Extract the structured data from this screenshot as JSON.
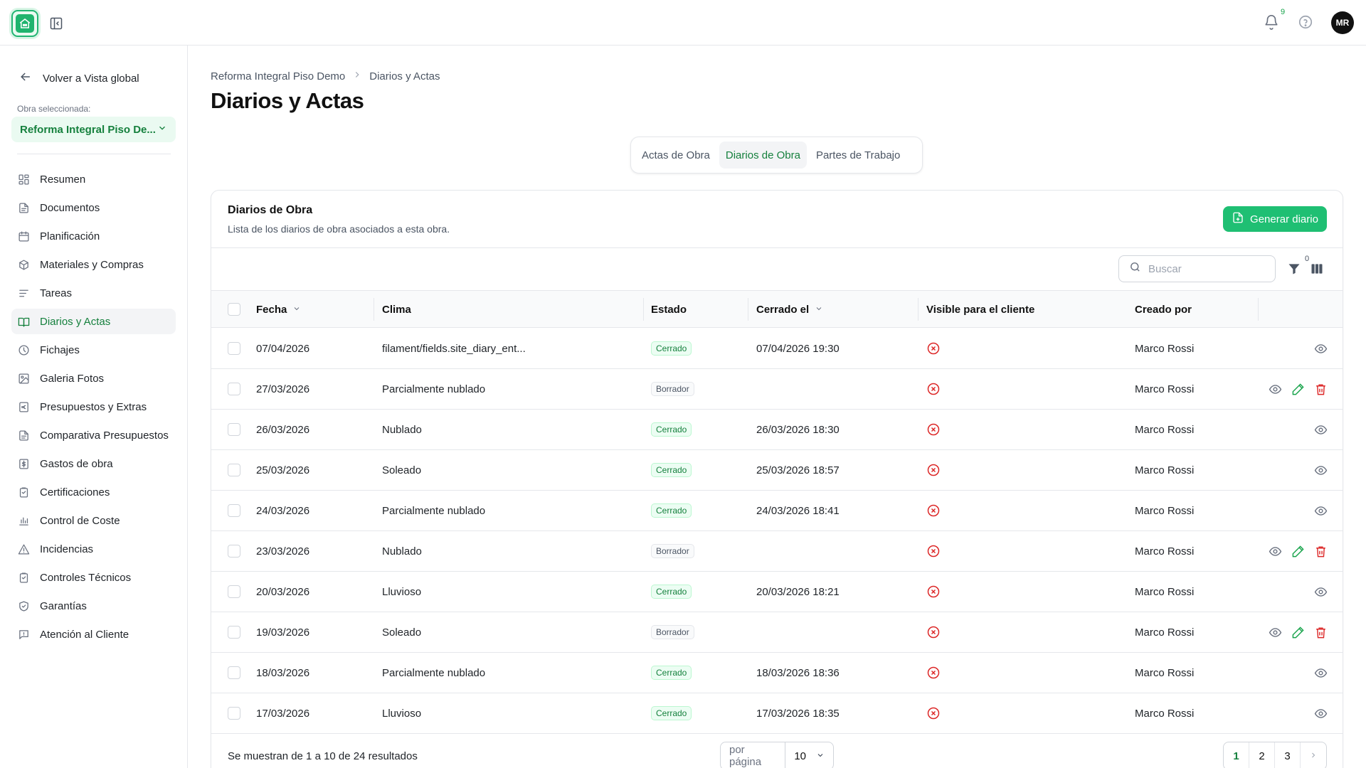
{
  "topbar": {
    "logo_icon": "house-icon",
    "collapse_icon": "sidebar-collapse-icon",
    "notifications_count": "9",
    "help_icon": "help-circle-icon",
    "avatar_initials": "MR",
    "accent_color": "#1fbf73"
  },
  "sidebar": {
    "back_label": "Volver a Vista global",
    "obra_label": "Obra seleccionada:",
    "obra_value": "Reforma Integral Piso De...",
    "items": [
      {
        "label": "Resumen",
        "icon": "grid-icon"
      },
      {
        "label": "Documentos",
        "icon": "document-icon"
      },
      {
        "label": "Planificación",
        "icon": "calendar-icon"
      },
      {
        "label": "Materiales y Compras",
        "icon": "box-icon"
      },
      {
        "label": "Tareas",
        "icon": "list-icon"
      },
      {
        "label": "Diarios y Actas",
        "icon": "book-icon",
        "active": true
      },
      {
        "label": "Fichajes",
        "icon": "clock-icon"
      },
      {
        "label": "Galeria Fotos",
        "icon": "photo-icon"
      },
      {
        "label": "Presupuestos y Extras",
        "icon": "euro-icon"
      },
      {
        "label": "Comparativa Presupuestos",
        "icon": "document-icon"
      },
      {
        "label": "Gastos de obra",
        "icon": "dollar-icon"
      },
      {
        "label": "Certificaciones",
        "icon": "clipboard-icon"
      },
      {
        "label": "Control de Coste",
        "icon": "bar-chart-icon"
      },
      {
        "label": "Incidencias",
        "icon": "warning-icon"
      },
      {
        "label": "Controles Técnicos",
        "icon": "clipboard-icon"
      },
      {
        "label": "Garantías",
        "icon": "shield-icon"
      },
      {
        "label": "Atención al Cliente",
        "icon": "message-icon"
      }
    ]
  },
  "main": {
    "breadcrumb": [
      "Reforma Integral Piso Demo",
      "Diarios y Actas"
    ],
    "title": "Diarios y Actas",
    "tabs": [
      {
        "label": "Actas de Obra"
      },
      {
        "label": "Diarios de Obra",
        "active": true
      },
      {
        "label": "Partes de Trabajo"
      }
    ]
  },
  "table_card": {
    "title": "Diarios de Obra",
    "description": "Lista de los diarios de obra asociados a esta obra.",
    "generate_button": "Generar diario",
    "search_placeholder": "Buscar",
    "filter_count": "0",
    "columns": [
      "Fecha",
      "Clima",
      "Estado",
      "Cerrado el",
      "Visible para el cliente",
      "Creado por"
    ],
    "rows": [
      {
        "fecha": "07/04/2026",
        "clima": "filament/fields.site_diary_ent...",
        "estado": "Cerrado",
        "cerrado_el": "07/04/2026 19:30",
        "creado_por": "Marco Rossi"
      },
      {
        "fecha": "27/03/2026",
        "clima": "Parcialmente nublado",
        "estado": "Borrador",
        "cerrado_el": "",
        "creado_por": "Marco Rossi"
      },
      {
        "fecha": "26/03/2026",
        "clima": "Nublado",
        "estado": "Cerrado",
        "cerrado_el": "26/03/2026 18:30",
        "creado_por": "Marco Rossi"
      },
      {
        "fecha": "25/03/2026",
        "clima": "Soleado",
        "estado": "Cerrado",
        "cerrado_el": "25/03/2026 18:57",
        "creado_por": "Marco Rossi"
      },
      {
        "fecha": "24/03/2026",
        "clima": "Parcialmente nublado",
        "estado": "Cerrado",
        "cerrado_el": "24/03/2026 18:41",
        "creado_por": "Marco Rossi"
      },
      {
        "fecha": "23/03/2026",
        "clima": "Nublado",
        "estado": "Borrador",
        "cerrado_el": "",
        "creado_por": "Marco Rossi"
      },
      {
        "fecha": "20/03/2026",
        "clima": "Lluvioso",
        "estado": "Cerrado",
        "cerrado_el": "20/03/2026 18:21",
        "creado_por": "Marco Rossi"
      },
      {
        "fecha": "19/03/2026",
        "clima": "Soleado",
        "estado": "Borrador",
        "cerrado_el": "",
        "creado_por": "Marco Rossi"
      },
      {
        "fecha": "18/03/2026",
        "clima": "Parcialmente nublado",
        "estado": "Cerrado",
        "cerrado_el": "18/03/2026 18:36",
        "creado_por": "Marco Rossi"
      },
      {
        "fecha": "17/03/2026",
        "clima": "Lluvioso",
        "estado": "Cerrado",
        "cerrado_el": "17/03/2026 18:35",
        "creado_por": "Marco Rossi"
      }
    ],
    "footer_text": "Se muestran de 1 a 10 de 24 resultados",
    "per_page_label": "por página",
    "per_page_value": "10",
    "pages": [
      "1",
      "2",
      "3"
    ]
  }
}
